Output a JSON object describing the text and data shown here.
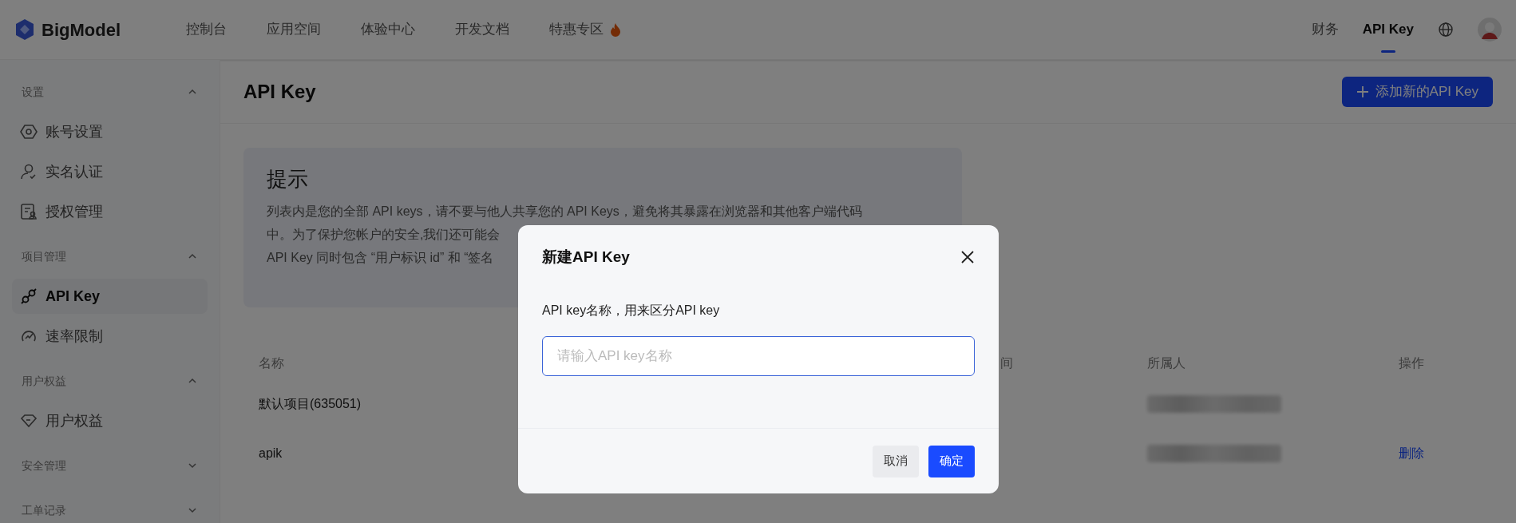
{
  "header": {
    "logo": "BigModel",
    "nav": [
      {
        "label": "控制台",
        "selected": false
      },
      {
        "label": "应用空间",
        "selected": false
      },
      {
        "label": "体验中心",
        "selected": false
      },
      {
        "label": "开发文档",
        "selected": false
      },
      {
        "label": "特惠专区",
        "selected": false,
        "hot": true
      }
    ],
    "right_nav": [
      {
        "label": "财务",
        "selected": false
      },
      {
        "label": "API Key",
        "selected": true
      }
    ]
  },
  "sidebar": {
    "groups": [
      {
        "title": "设置",
        "expanded": true,
        "items": [
          {
            "label": "账号设置",
            "selected": false
          },
          {
            "label": "实名认证",
            "selected": false
          },
          {
            "label": "授权管理",
            "selected": false
          }
        ]
      },
      {
        "title": "项目管理",
        "expanded": true,
        "items": [
          {
            "label": "API Key",
            "selected": true
          },
          {
            "label": "速率限制",
            "selected": false
          }
        ]
      },
      {
        "title": "用户权益",
        "expanded": true,
        "items": [
          {
            "label": "用户权益",
            "selected": false
          }
        ]
      },
      {
        "title": "安全管理",
        "expanded": false
      },
      {
        "title": "工单记录",
        "expanded": false
      }
    ]
  },
  "page": {
    "title": "API Key",
    "add_button": "添加新的API Key"
  },
  "hint": {
    "title": "提示",
    "lines": [
      "列表内是您的全部 API keys，请不要与他人共享您的 API Keys，避免将其暴露在浏览器和其他客户端代码",
      "中。为了保护您帐户的安全,我们还可能会",
      "API Key 同时包含 “用户标识 id” 和 “签名"
    ]
  },
  "table": {
    "columns": [
      {
        "label": "名称"
      },
      {
        "label": "间"
      },
      {
        "label": "所属人"
      },
      {
        "label": "操作"
      }
    ],
    "rows": [
      {
        "name": "默认项目(635051)"
      },
      {
        "name": "apik",
        "action": "删除"
      }
    ]
  },
  "modal": {
    "title": "新建API Key",
    "field_label": "API key名称，用来区分API key",
    "placeholder": "请输入API key名称",
    "buttons": [
      {
        "label": "取消",
        "kind": "secondary"
      },
      {
        "label": "确定",
        "kind": "primary"
      }
    ]
  }
}
